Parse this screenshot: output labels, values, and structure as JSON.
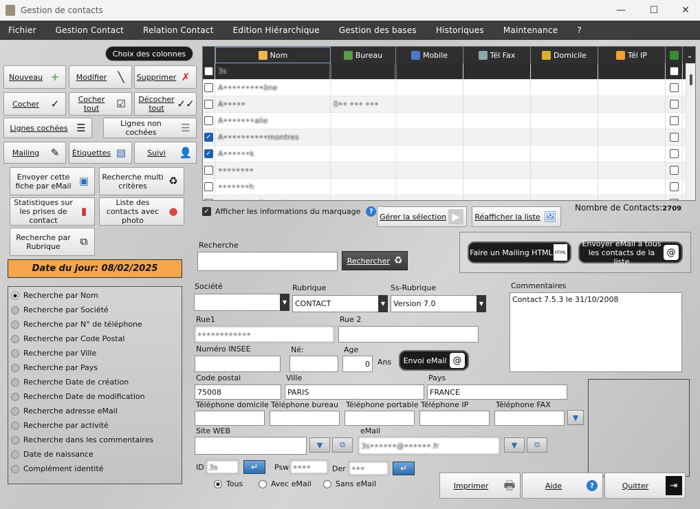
{
  "window": {
    "title": "Gestion de contacts",
    "min": "—",
    "max": "☐",
    "close": "✕"
  },
  "menu": [
    "Fichier",
    "Gestion Contact",
    "Relation Contact",
    "Edition Hiérarchique",
    "Gestion des bases",
    "Historiques",
    "Maintenance",
    "?"
  ],
  "left": {
    "choix_colonnes": "Choix des colonnes",
    "nouveau": "Nouveau",
    "modifier": "Modifier",
    "supprimer": "Supprimer",
    "cocher": "Cocher",
    "cocher_tout": "Cocher tout",
    "decocher_tout": "Décocher tout",
    "lignes_cochees": "Lignes cochées",
    "lignes_non_cochees": "Lignes non cochées",
    "mailing": "Mailing",
    "etiquettes": "Étiquettes",
    "suivi": "Suivi",
    "envoyer_fiche": "Envoyer cette fiche par eMail",
    "recherche_multi": "Recherche multi critères",
    "statistiques": "Statistiques sur les prises de contact",
    "liste_photo": "Liste des contacts avec photo",
    "recherche_rubrique": "Recherche par Rubrique",
    "date_du_jour": "Date du jour: 08/02/2025",
    "search_modes": [
      "Recherche par Nom",
      "Recherche par Société",
      "Recherche par N° de téléphone",
      "Recherche par Code Postal",
      "Recherche par Ville",
      "Recherche par Pays",
      "Recherche Date de création",
      "Recherche Date de modification",
      "Recherche adresse eMail",
      "Recherche par activité",
      "Recherche dans les commentaires",
      "Date de naissance",
      "Complément identité"
    ]
  },
  "grid": {
    "columns": [
      "Nom",
      "Bureau",
      "Mobile",
      "Tél Fax",
      "Domicile",
      "Tél IP"
    ],
    "rows": [
      {
        "nom": "3s",
        "bureau": "",
        "checked": false,
        "selected": true
      },
      {
        "nom": "A•••••••••ône",
        "bureau": "",
        "checked": false
      },
      {
        "nom": "A•••••",
        "bureau": "0•• ••• •••",
        "checked": false
      },
      {
        "nom": "A•••••••alie",
        "bureau": "",
        "checked": false
      },
      {
        "nom": "A••••••••••montres",
        "bureau": "",
        "checked": true
      },
      {
        "nom": "A••••••k",
        "bureau": "",
        "checked": true
      },
      {
        "nom": "••••••••",
        "bureau": "",
        "checked": false
      },
      {
        "nom": "•••••••h",
        "bureau": "",
        "checked": false
      },
      {
        "nom": "Abdelkrim Bouzain",
        "bureau": "",
        "checked": false
      }
    ]
  },
  "below_grid": {
    "afficher_marquage": "Afficher les informations du marquage",
    "gerer_selection": "Gérer la sélection",
    "reafficher": "Réafficher la liste",
    "nb_contacts_label": "Nombre de Contacts:",
    "nb_contacts": "2709"
  },
  "mailing_box": {
    "mailing_html": "Faire un  Mailing HTML",
    "envoyer_tous": "Envoyer eMail à tous les contacts de la liste"
  },
  "recherche": {
    "label": "Recherche",
    "value": "",
    "button": "Rechercher"
  },
  "form": {
    "societe_label": "Société",
    "societe": "",
    "rubrique_label": "Rubrique",
    "rubrique": "CONTACT",
    "ssrubrique_label": "Ss-Rubrique",
    "ssrubrique": "Version 7.0",
    "commentaires_label": "Commentaires",
    "commentaires": "Contact 7.5.3 le 31/10/2008",
    "rue1_label": "Rue1",
    "rue1": "••••••••••••",
    "rue2_label": "Rue 2",
    "rue2": "",
    "insee_label": "Numéro INSEE",
    "insee": "",
    "ne_label": "Né:",
    "ne": "",
    "age_label": "Age",
    "age": "0",
    "ans": "Ans",
    "envoi_email": "Envoi eMail",
    "cp_label": "Code postal",
    "cp": "75008",
    "ville_label": "Ville",
    "ville": "PARIS",
    "pays_label": "Pays",
    "pays": "FRANCE",
    "tel_dom_label": "Téléphone domicile",
    "tel_bur_label": "Téléphone bureau",
    "tel_port_label": "Téléphone portable",
    "tel_ip_label": "Téléphone IP",
    "tel_fax_label": "Téléphone FAX",
    "site_label": "Site WEB",
    "site": "",
    "email_label": "eMail",
    "email": "3s••••••@••••••.fr",
    "id_label": "ID",
    "id": "3s",
    "psw_label": "Psw",
    "psw": "••••",
    "der_label": "Der",
    "der": "•••",
    "filter_tous": "Tous",
    "filter_avec": "Avec eMail",
    "filter_sans": "Sans eMail",
    "imprimer": "Imprimer",
    "aide": "Aide",
    "quitter": "Quitter"
  }
}
